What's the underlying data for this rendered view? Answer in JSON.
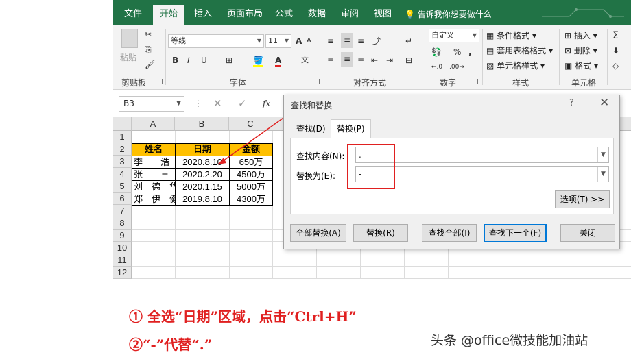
{
  "tabs": [
    "文件",
    "开始",
    "插入",
    "页面布局",
    "公式",
    "数据",
    "审阅",
    "视图"
  ],
  "active_tab": "开始",
  "tell_me": "告诉我你想要做什么",
  "ribbon": {
    "clipboard": {
      "paste": "粘贴",
      "group": "剪贴板"
    },
    "font": {
      "name": "等线",
      "size": "11",
      "group": "字体",
      "bold": "B",
      "italic": "I",
      "underline": "U",
      "grow": "A",
      "shrink": "A",
      "wen": "文"
    },
    "alignment": {
      "group": "对齐方式"
    },
    "number": {
      "format": "自定义",
      "group": "数字",
      "percent": "%",
      "comma": ","
    },
    "styles": {
      "conditional": "条件格式",
      "table": "套用表格格式",
      "cell": "单元格样式",
      "group": "样式"
    },
    "cells": {
      "insert": "插入",
      "delete": "删除",
      "format": "格式",
      "group": "单元格"
    }
  },
  "formula_bar": {
    "name_box": "B3",
    "fx": "fx"
  },
  "sheet": {
    "columns": [
      "A",
      "B",
      "C"
    ],
    "rows": [
      "1",
      "2",
      "3",
      "4",
      "5",
      "6",
      "7",
      "8",
      "9",
      "10",
      "11",
      "12"
    ],
    "headers": [
      "姓名",
      "日期",
      "金额"
    ],
    "data": [
      [
        "李　　浩",
        "2020.8.10",
        "650万"
      ],
      [
        "张　　三",
        "2020.2.20",
        "4500万"
      ],
      [
        "刘　德　华",
        "2020.1.15",
        "5000万"
      ],
      [
        "郑　伊　健",
        "2019.8.10",
        "4300万"
      ]
    ]
  },
  "dialog": {
    "title": "查找和替换",
    "help": "?",
    "close": "✕",
    "tab_find": "查找(D)",
    "tab_replace": "替换(P)",
    "find_label": "查找内容(N):",
    "find_value": ".",
    "replace_label": "替换为(E):",
    "replace_value": "-",
    "options_btn": "选项(T) >>",
    "replace_all": "全部替换(A)",
    "replace": "替换(R)",
    "find_all": "查找全部(I)",
    "find_next": "查找下一个(F)",
    "close_btn": "关闭"
  },
  "annotations": {
    "step1": "① 全选“日期”区域，点击“Ctrl+H”",
    "step2": "②“-”代替“.”",
    "watermark": "头条 @office微技能加油站"
  },
  "colors": {
    "excel_green": "#217346",
    "header_fill": "#ffc000",
    "annotation_red": "#e02020"
  }
}
